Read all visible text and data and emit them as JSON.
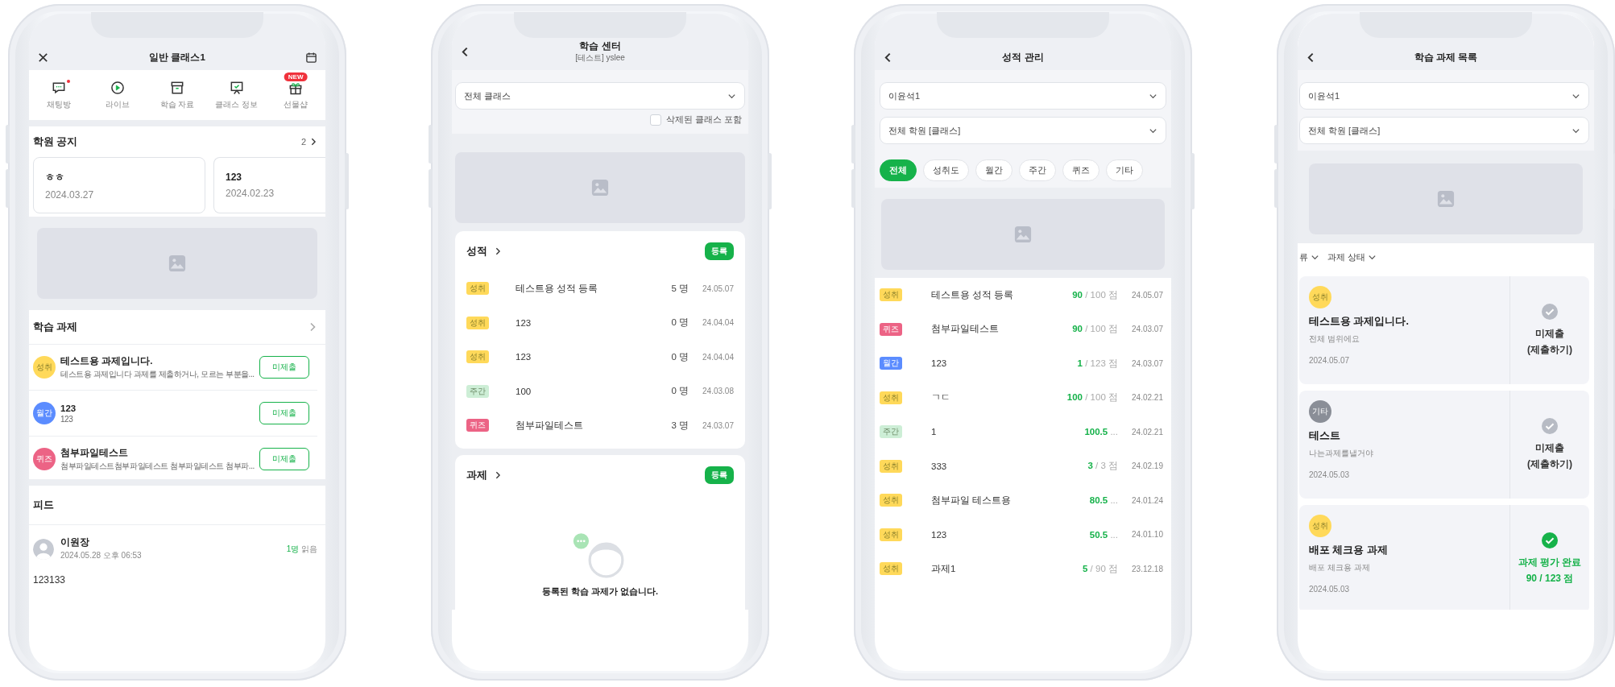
{
  "class_home": {
    "header": {
      "title": "일반 클래스1"
    },
    "menu": [
      {
        "kind": "chat",
        "label": "채팅방",
        "unread": true
      },
      {
        "kind": "live",
        "label": "라이브",
        "unread": false
      },
      {
        "kind": "archive",
        "label": "학습 자료",
        "unread": false
      },
      {
        "kind": "board",
        "label": "클래스 정보",
        "unread": false
      },
      {
        "kind": "gift",
        "label": "선물샵",
        "unread": false,
        "badge": "NEW"
      }
    ],
    "notices": {
      "title": "학원 공지",
      "count": "2",
      "cards": [
        {
          "title": "ㅎㅎ",
          "date": "2024.03.27"
        },
        {
          "title": "123",
          "date": "2024.02.23"
        }
      ]
    },
    "assignments": {
      "title": "학습 과제",
      "items": [
        {
          "tag": "성취",
          "color": "#ffd95a",
          "title": "테스트용 과제입니다.",
          "desc": "테스트용 과제입니다 과제를 제출하거나, 모르는 부분을...",
          "action": "미제출"
        },
        {
          "tag": "월간",
          "color": "#5b8cff",
          "title": "123",
          "desc": "123",
          "action": "미제출"
        },
        {
          "tag": "퀴즈",
          "color": "#ec6385",
          "title": "첨부파일테스트",
          "desc": "첨부파일테스트첨부파일테스트 첨부파일테스트 첨부파...",
          "action": "미제출"
        }
      ]
    },
    "feed": {
      "title": "피드",
      "post": {
        "author": "이원장",
        "time": "2024.05.28 오후 06:53",
        "read_count": "1명",
        "read_label": "읽음",
        "body": "123133"
      }
    }
  },
  "learning_center": {
    "header": {
      "title": "학습 센터",
      "subtitle": "[테스트] yslee"
    },
    "class_select": {
      "value": "전체 클래스"
    },
    "include_deleted": {
      "label": "삭제된 클래스 포함",
      "checked": false
    },
    "grades": {
      "title": "성적",
      "button": "등록",
      "rows": [
        {
          "tag": "성취",
          "color": "#ffd95a",
          "name": "테스트용 성적 등록",
          "count": "5 명",
          "date": "24.05.07"
        },
        {
          "tag": "성취",
          "color": "#ffd95a",
          "name": "123",
          "count": "0 명",
          "date": "24.04.04"
        },
        {
          "tag": "성취",
          "color": "#ffd95a",
          "name": "123",
          "count": "0 명",
          "date": "24.04.04"
        },
        {
          "tag": "주간",
          "color": "#cdeed6",
          "name": "100",
          "count": "0 명",
          "date": "24.03.08"
        },
        {
          "tag": "퀴즈",
          "color": "#ec6385",
          "name": "첨부파일테스트",
          "count": "3 명",
          "date": "24.03.07"
        }
      ]
    },
    "assignments": {
      "title": "과제",
      "button": "등록",
      "empty_message": "등록된 학습 과제가 없습니다."
    }
  },
  "grade_management": {
    "header": {
      "title": "성적 관리"
    },
    "student_select": {
      "value": "이윤석1"
    },
    "academy_select": {
      "value": "전체 학원 [클래스]"
    },
    "filters": [
      {
        "label": "전체",
        "selected": true
      },
      {
        "label": "성취도",
        "selected": false
      },
      {
        "label": "월간",
        "selected": false
      },
      {
        "label": "주간",
        "selected": false
      },
      {
        "label": "퀴즈",
        "selected": false
      },
      {
        "label": "기타",
        "selected": false
      }
    ],
    "rows": [
      {
        "tag": "성취",
        "color": "#ffd95a",
        "name": "테스트용 성적 등록",
        "score": "90",
        "total": "/ 100 점",
        "date": "24.05.07"
      },
      {
        "tag": "퀴즈",
        "color": "#ec6385",
        "name": "첨부파일테스트",
        "score": "90",
        "total": "/ 100 점",
        "date": "24.03.07"
      },
      {
        "tag": "월간",
        "color": "#5b8cff",
        "name": "123",
        "score": "1",
        "total": "/ 123 점",
        "date": "24.03.07"
      },
      {
        "tag": "성취",
        "color": "#ffd95a",
        "name": "ㄱㄷ",
        "score": "100",
        "total": "/ 100 점",
        "date": "24.02.21"
      },
      {
        "tag": "주간",
        "color": "#cdeed6",
        "name": "1",
        "score": "100.5",
        "total": "...",
        "date": "24.02.21"
      },
      {
        "tag": "성취",
        "color": "#ffd95a",
        "name": "333",
        "score": "3",
        "total": "/ 3 점",
        "date": "24.02.19"
      },
      {
        "tag": "성취",
        "color": "#ffd95a",
        "name": "첨부파일 테스트용",
        "score": "80.5",
        "total": "...",
        "date": "24.01.24"
      },
      {
        "tag": "성취",
        "color": "#ffd95a",
        "name": "123",
        "score": "50.5",
        "total": "...",
        "date": "24.01.10"
      },
      {
        "tag": "성취",
        "color": "#ffd95a",
        "name": "과제1",
        "score": "5",
        "total": "/ 90 점",
        "date": "23.12.18"
      }
    ]
  },
  "assignment_list": {
    "header": {
      "title": "학습 과제 목록"
    },
    "student_select": {
      "value": "이윤석1"
    },
    "academy_select": {
      "value": "전체 학원 [클래스]"
    },
    "filters": [
      {
        "label": "류"
      },
      {
        "label": "과제 상태"
      }
    ],
    "items": [
      {
        "tag": "성취",
        "color": "#ffd95a",
        "title": "테스트용 과제입니다.",
        "desc": "전체 범위에요",
        "date": "2024.05.07",
        "done": false,
        "status": "미제출",
        "action": "(제출하기)"
      },
      {
        "tag": "기타",
        "color": "#8a8e97",
        "title": "테스트",
        "desc": "나는과제를낼거야",
        "date": "2024.05.03",
        "done": false,
        "status": "미제출",
        "action": "(제출하기)"
      },
      {
        "tag": "성취",
        "color": "#ffd95a",
        "title": "배포 체크용 과제",
        "desc": "배포 체크용 과제",
        "date": "2024.05.03",
        "done": true,
        "status": "과제 평가 완료",
        "action": "90 / 123 점"
      }
    ]
  }
}
